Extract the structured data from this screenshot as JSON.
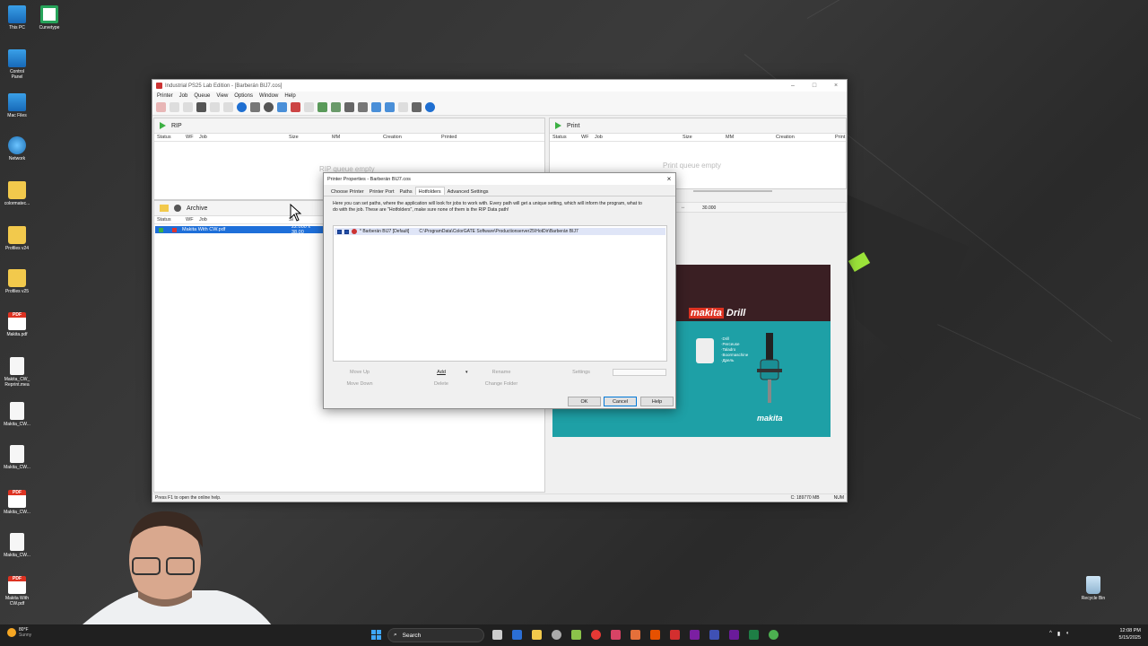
{
  "desktop_icons": [
    {
      "label": "This PC",
      "icon": "pc-icon",
      "type": "pc"
    },
    {
      "label": "Curvetype",
      "icon": "excel-icon",
      "type": "xls"
    },
    {
      "label": "Control Panel",
      "icon": "control-panel-icon",
      "type": "pc"
    },
    {
      "label": "Mac Files",
      "icon": "folder-icon",
      "type": "pc"
    },
    {
      "label": "Network",
      "icon": "network-icon",
      "type": "net"
    },
    {
      "label": "colormatec...",
      "icon": "folder-icon",
      "type": "folder"
    },
    {
      "label": "Profiles v24",
      "icon": "folder-icon",
      "type": "folder"
    },
    {
      "label": "Profiles v25",
      "icon": "folder-icon",
      "type": "folder"
    },
    {
      "label": "Makita.pdf",
      "icon": "pdf-icon",
      "type": "pdf"
    },
    {
      "label": "Makita_CW_ Reprint.mea",
      "icon": "document-icon",
      "type": "doc"
    },
    {
      "label": "Makita_CW...",
      "icon": "document-icon",
      "type": "doc"
    },
    {
      "label": "Makita_CW...",
      "icon": "document-icon",
      "type": "doc"
    },
    {
      "label": "Makita_CW...",
      "icon": "pdf-icon",
      "type": "pdf"
    },
    {
      "label": "Makita_CW...",
      "icon": "document-icon",
      "type": "doc"
    },
    {
      "label": "Makita With CW.pdf",
      "icon": "pdf-icon",
      "type": "pdf"
    }
  ],
  "recycle_bin": {
    "label": "Recycle Bin"
  },
  "app": {
    "title": "Industrial PS25 Lab Edition - [Barberán BIJ7.cos]",
    "menu": [
      "Printer",
      "Job",
      "Queue",
      "View",
      "Options",
      "Window",
      "Help"
    ],
    "rip_panel": {
      "title": "RIP",
      "columns": [
        "Status",
        "WF",
        "Job",
        "Size",
        "MM",
        "Creation",
        "Printed"
      ],
      "empty_text": "RIP queue empty"
    },
    "print_panel": {
      "title": "Print",
      "columns": [
        "Status",
        "WF",
        "Job",
        "Size",
        "MM",
        "Creation",
        "Print"
      ],
      "empty_text": "Print queue empty"
    },
    "archive_panel": {
      "title": "Archive",
      "columns": [
        "Status",
        "WF",
        "Job",
        "Si"
      ],
      "row_name": "Makita With CW.pdf",
      "row_size": "22.000 x 38.00"
    },
    "preview_toolbar": {
      "value": "30.000"
    },
    "preview": {
      "brand": "makita",
      "product": "Drill",
      "features": [
        "·Drill",
        "·Perceuse",
        "·Taladro",
        "·Boormaschine",
        "·Дрель"
      ]
    },
    "status_left": "Press F1 to open the online help.",
    "status_right": "C: 189770 MB",
    "status_num": "NUM"
  },
  "dialog": {
    "title": "Printer Properties - Barberán BIJ7.cos",
    "tabs": [
      "Choose Printer",
      "Printer Port",
      "Paths",
      "Hotfolders",
      "Advanced Settings"
    ],
    "active_tab": "Hotfolders",
    "description": "Here you can set paths, where the application will look for jobs to work with. Every path will get a unique setting, which will inform the program, what to do with the job. These are \"Hotfolders\", make sure none of them is the RIP Data path!",
    "hotfolder": {
      "name": "* Barberán BIJ7 [Default]",
      "path": "C:\\ProgramData\\ColorGATE Software\\Productionserver25\\HotDir\\Barberán BIJ7"
    },
    "buttons": {
      "move_up": "Move Up",
      "move_down": "Move Down",
      "add": "Add",
      "delete": "Delete",
      "rename": "Rename",
      "change_folder": "Change Folder",
      "settings": "Settings",
      "ok": "OK",
      "cancel": "Cancel",
      "help": "Help"
    }
  },
  "taskbar": {
    "search_placeholder": "Search",
    "weather_temp": "80°F",
    "weather_desc": "Sunny",
    "time": "12:08 PM",
    "date": "5/15/2025"
  }
}
